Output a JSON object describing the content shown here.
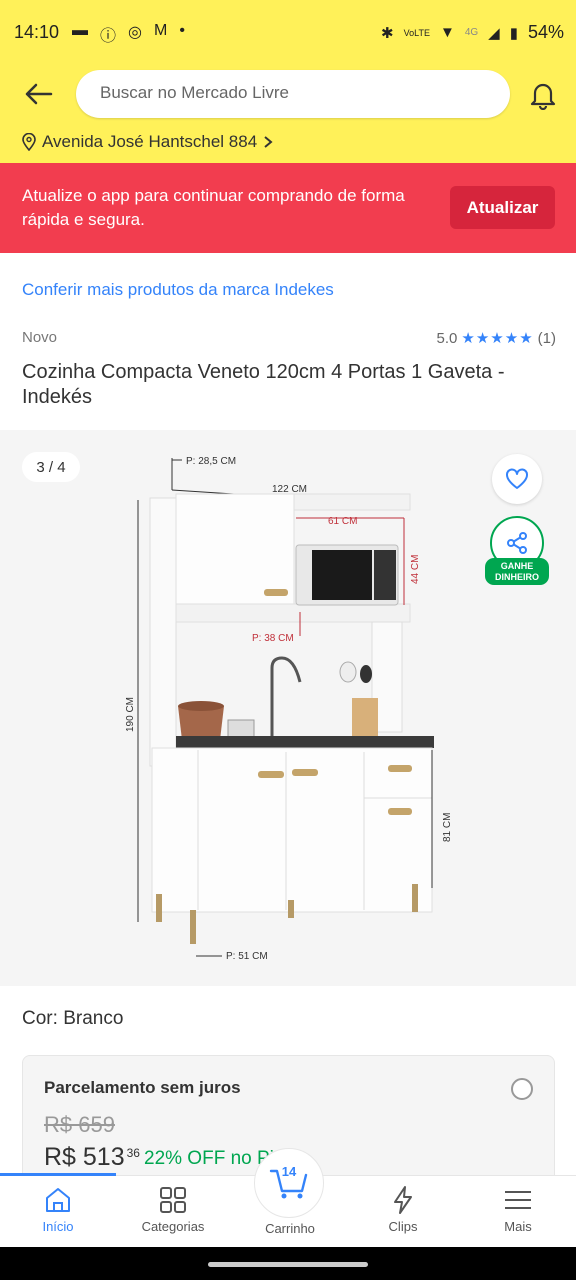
{
  "status_bar": {
    "time": "14:10",
    "battery": "54%",
    "network": "4G"
  },
  "header": {
    "search_placeholder": "Buscar no Mercado Livre",
    "address": "Avenida José Hantschel 884"
  },
  "update_banner": {
    "text": "Atualize o app para continuar comprando de forma rápida e segura.",
    "button_label": "Atualizar"
  },
  "brand_link": "Conferir mais produtos da marca Indekes",
  "product": {
    "condition": "Novo",
    "rating_value": "5.0",
    "rating_count": "(1)",
    "title": "Cozinha Compacta Veneto 120cm 4 Portas 1 Gaveta - Indekés",
    "image_counter": "3 / 4",
    "share_badge": "GANHE DINHEIRO",
    "dimensions": {
      "depth_top": "P: 28,5 CM",
      "width_top": "122 CM",
      "niche_width": "61 CM",
      "niche_height": "44 CM",
      "depth_mid": "P: 38 CM",
      "height_total": "190 CM",
      "height_base": "81 CM",
      "depth_base": "P: 51 CM"
    },
    "color_label": "Cor:",
    "color_value": "Branco"
  },
  "payment": {
    "title": "Parcelamento sem juros",
    "old_price": "R$ 659",
    "price_main": "R$ 513",
    "price_cents": "36",
    "off_text": "22% OFF no Pi"
  },
  "bottom_nav": {
    "items": [
      {
        "label": "Início"
      },
      {
        "label": "Categorias"
      },
      {
        "label": "Carrinho"
      },
      {
        "label": "Clips"
      },
      {
        "label": "Mais"
      }
    ],
    "cart_count": "14"
  },
  "colors": {
    "header_yellow": "#fff159",
    "banner_red": "#f23d4f",
    "link_blue": "#3483fa",
    "success_green": "#00a650"
  }
}
